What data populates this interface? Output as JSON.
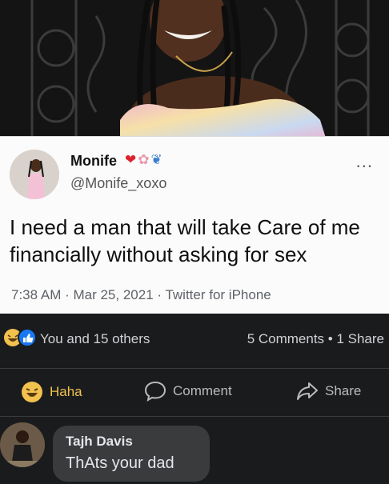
{
  "tweet": {
    "display_name": "Monife",
    "handle": "@Monife_xoxo",
    "badges": [
      "heart",
      "flower",
      "butterfly"
    ],
    "more_label": "...",
    "text": "I need a man that will take Care of me financially without asking for sex",
    "meta": "7:38 AM · Mar 25, 2021 · Twitter for iPhone"
  },
  "post": {
    "reactions_text": "You and 15 others",
    "comments_shares_text": "5 Comments • 1 Share"
  },
  "actions": {
    "haha_label": "Haha",
    "comment_label": "Comment",
    "share_label": "Share"
  },
  "comment": {
    "author": "Tajh Davis",
    "text": "ThAts your dad"
  },
  "colors": {
    "haha": "#f2c14e",
    "like_blue": "#1877f2",
    "background": "#1a1b1d",
    "bubble": "#3a3b3d"
  }
}
